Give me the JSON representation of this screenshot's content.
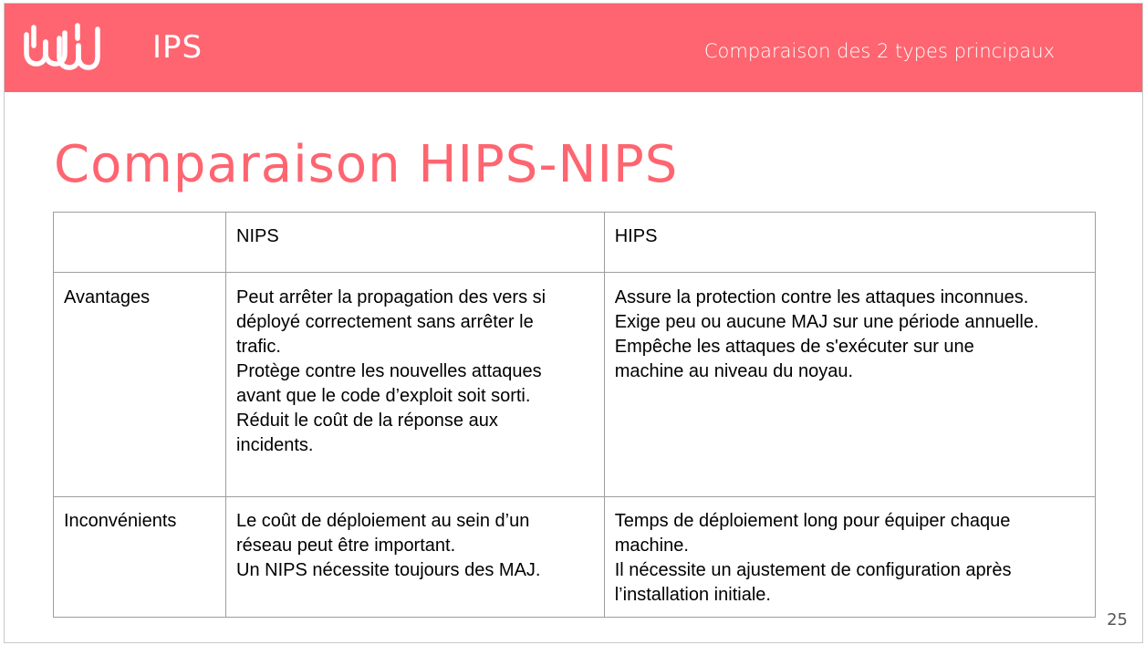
{
  "header": {
    "logo": "ww-logo-icon",
    "title": "IPS",
    "subtitle": "Comparaison des 2 types principaux"
  },
  "page_title": "Comparaison HIPS-NIPS",
  "table": {
    "header": [
      "",
      "NIPS",
      "HIPS"
    ],
    "rows": [
      {
        "label": "Avantages",
        "nips": [
          "Peut arrêter la propagation des vers si",
          "déployé correctement sans arrêter le",
          "trafic.",
          "Protège contre les nouvelles attaques",
          "avant que le code d’exploit soit sorti.",
          "Réduit le coût de la réponse aux",
          "incidents."
        ],
        "hips": [
          "Assure la protection contre les attaques inconnues.",
          "Exige peu ou aucune MAJ sur une période annuelle.",
          "Empêche les attaques de s'exécuter sur une",
          "machine au niveau du noyau."
        ]
      },
      {
        "label": "Inconvénients",
        "nips": [
          "Le coût de déploiement au sein d’un",
          "réseau peut être important.",
          "Un NIPS nécessite toujours des MAJ."
        ],
        "hips": [
          "Temps de déploiement long pour équiper chaque",
          "machine.",
          "Il nécessite un ajustement de configuration après",
          "l’installation initiale."
        ]
      }
    ]
  },
  "page_number": "25",
  "colors": {
    "accent": "#fe6570",
    "border": "#9e9e9e",
    "text": "#000000"
  }
}
